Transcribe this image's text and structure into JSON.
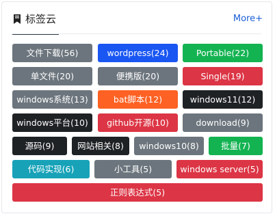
{
  "header": {
    "title": "标签云",
    "more_label": "More+"
  },
  "tags": [
    {
      "label": "文件下载(56)",
      "color": "gray"
    },
    {
      "label": "wordpress(24)",
      "color": "blue"
    },
    {
      "label": "Portable(22)",
      "color": "green"
    },
    {
      "label": "单文件(20)",
      "color": "gray"
    },
    {
      "label": "便携版(20)",
      "color": "gray"
    },
    {
      "label": "Single(19)",
      "color": "red"
    },
    {
      "label": "windows系统(13)",
      "color": "gray"
    },
    {
      "label": "bat脚本(12)",
      "color": "orange"
    },
    {
      "label": "windows11(12)",
      "color": "dark"
    },
    {
      "label": "windows平台(10)",
      "color": "dark"
    },
    {
      "label": "github开源(10)",
      "color": "red"
    },
    {
      "label": "download(9)",
      "color": "gray"
    },
    {
      "label": "源码(9)",
      "color": "dark"
    },
    {
      "label": "网站相关(8)",
      "color": "dark"
    },
    {
      "label": "windows10(8)",
      "color": "gray"
    },
    {
      "label": "批量(7)",
      "color": "green"
    },
    {
      "label": "代码实现(6)",
      "color": "teal"
    },
    {
      "label": "小工具(5)",
      "color": "gray"
    },
    {
      "label": "windows server(5)",
      "color": "red"
    },
    {
      "label": "正则表达式(5)",
      "color": "red"
    }
  ],
  "colors": {
    "gray": "#6c757d",
    "blue": "#1a56f2",
    "green": "#14b352",
    "red": "#dc3545",
    "orange": "#fd6123",
    "dark": "#1f2225",
    "teal": "#17a2b8",
    "link": "#1a5fd6"
  },
  "icons": {
    "title_icon": "bookmark-icon"
  }
}
